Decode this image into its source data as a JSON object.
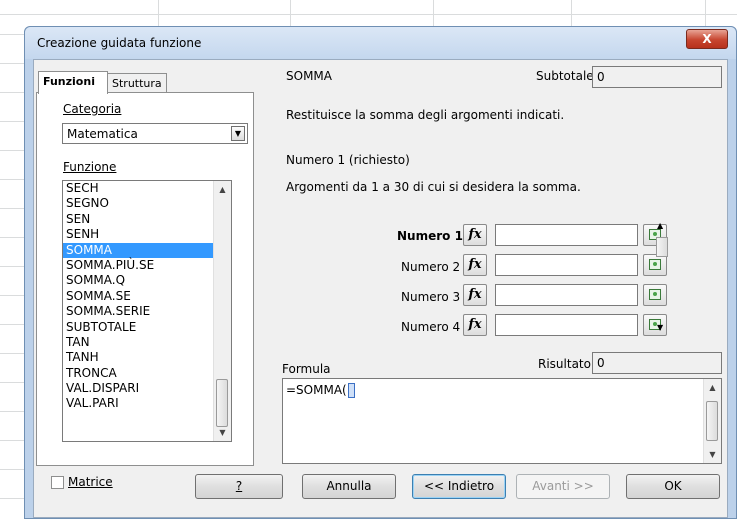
{
  "dialog": {
    "title": "Creazione guidata funzione",
    "close_label": "X"
  },
  "tabs": [
    {
      "label": "Funzioni"
    },
    {
      "label": "Struttura"
    }
  ],
  "left": {
    "category_label": "Categoria",
    "category_value": "Matematica",
    "function_label": "Funzione",
    "functions": [
      "SECH",
      "SEGNO",
      "SEN",
      "SENH",
      "SOMMA",
      "SOMMA.PIÙ.SE",
      "SOMMA.Q",
      "SOMMA.SE",
      "SOMMA.SERIE",
      "SUBTOTALE",
      "TAN",
      "TANH",
      "TRONCA",
      "VAL.DISPARI",
      "VAL.PARI"
    ],
    "selected_function": "SOMMA"
  },
  "right": {
    "function_name": "SOMMA",
    "subtotal_label": "Subtotale",
    "subtotal_value": "0",
    "description": "Restituisce la somma degli argomenti indicati.",
    "arg_title": "Numero 1 (richiesto)",
    "arg_desc": "Argomenti da 1 a 30 di cui si desidera la somma.",
    "args": [
      {
        "label": "Numero 1",
        "value": ""
      },
      {
        "label": "Numero 2",
        "value": ""
      },
      {
        "label": "Numero 3",
        "value": ""
      },
      {
        "label": "Numero 4",
        "value": ""
      }
    ],
    "fx_label": "fx",
    "formula_label": "Formula",
    "result_label": "Risultato",
    "result_value": "0",
    "formula_text": "=SOMMA("
  },
  "bottom": {
    "matrix_label": "Matrice",
    "help_label": "?",
    "cancel_label": "Annulla",
    "back_label": "<< Indietro",
    "next_label": "Avanti >>",
    "ok_label": "OK"
  }
}
